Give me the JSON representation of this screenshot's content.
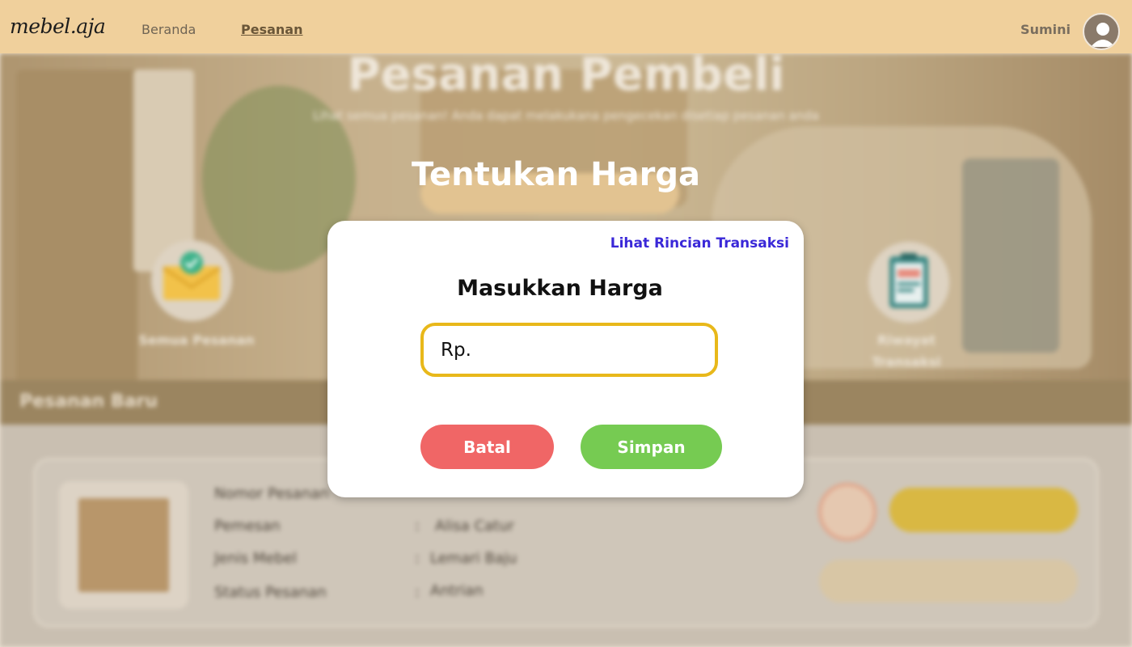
{
  "navbar": {
    "logo": "mebel.aja",
    "links": [
      "Beranda",
      "Pesanan"
    ],
    "active_link": "Pesanan",
    "user_name": "Sumini"
  },
  "background": {
    "hero_title": "Pesanan Pembeli",
    "hero_subtitle": "Lihat semua pesanan! Anda dapat melakukana pengecekan disetiap pesanan anda",
    "menu": [
      {
        "label": "Semua Pesanan",
        "icon": "envelope-check-icon"
      },
      {
        "label": "Riwayat Transaksi",
        "icon": "clipboard-icon"
      }
    ],
    "section_title": "Pesanan Baru",
    "order": {
      "labels": [
        "Nomor Pesanan",
        "Pemesan",
        "Jenis Mebel",
        "Status Pesanan"
      ],
      "values": [
        "",
        "Alisa Catur",
        "Lemari Baju",
        "Antrian"
      ],
      "action_primary": "Tentukan Harga",
      "action_secondary": "Lihat Rincian Transaksi"
    }
  },
  "modal": {
    "title": "Tentukan Harga",
    "link": "Lihat Rincian Transaksi",
    "heading": "Masukkan Harga",
    "price_placeholder": "Rp.",
    "cancel_label": "Batal",
    "save_label": "Simpan"
  },
  "colors": {
    "navbar": "#f0d09c",
    "input_border": "#e8b81a",
    "cancel": "#f06666",
    "save": "#76cb52",
    "link": "#3a28d8"
  }
}
